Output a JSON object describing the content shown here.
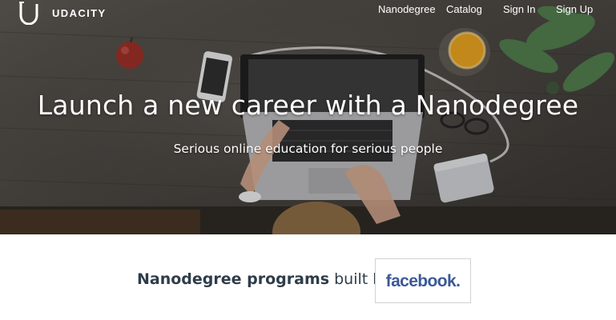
{
  "brand": {
    "name": "UDACITY",
    "mark_icon": "udacity-u-logo-icon"
  },
  "nav": {
    "items": [
      {
        "label": "Nanodegree"
      },
      {
        "label": "Catalog"
      },
      {
        "label": "Sign In"
      },
      {
        "label": "Sign Up"
      }
    ]
  },
  "hero": {
    "title": "Launch a new career with a Nanodegree",
    "subtitle": "Serious online education for serious people",
    "background_icon": "desk-laptop-photo"
  },
  "partner": {
    "text_strong": "Nanodegree programs",
    "text_rest": "built by",
    "logo_text": "facebook.",
    "logo_color": "#3b5998"
  },
  "colors": {
    "body_text": "#2e3d49",
    "hero_text": "#ffffff"
  }
}
